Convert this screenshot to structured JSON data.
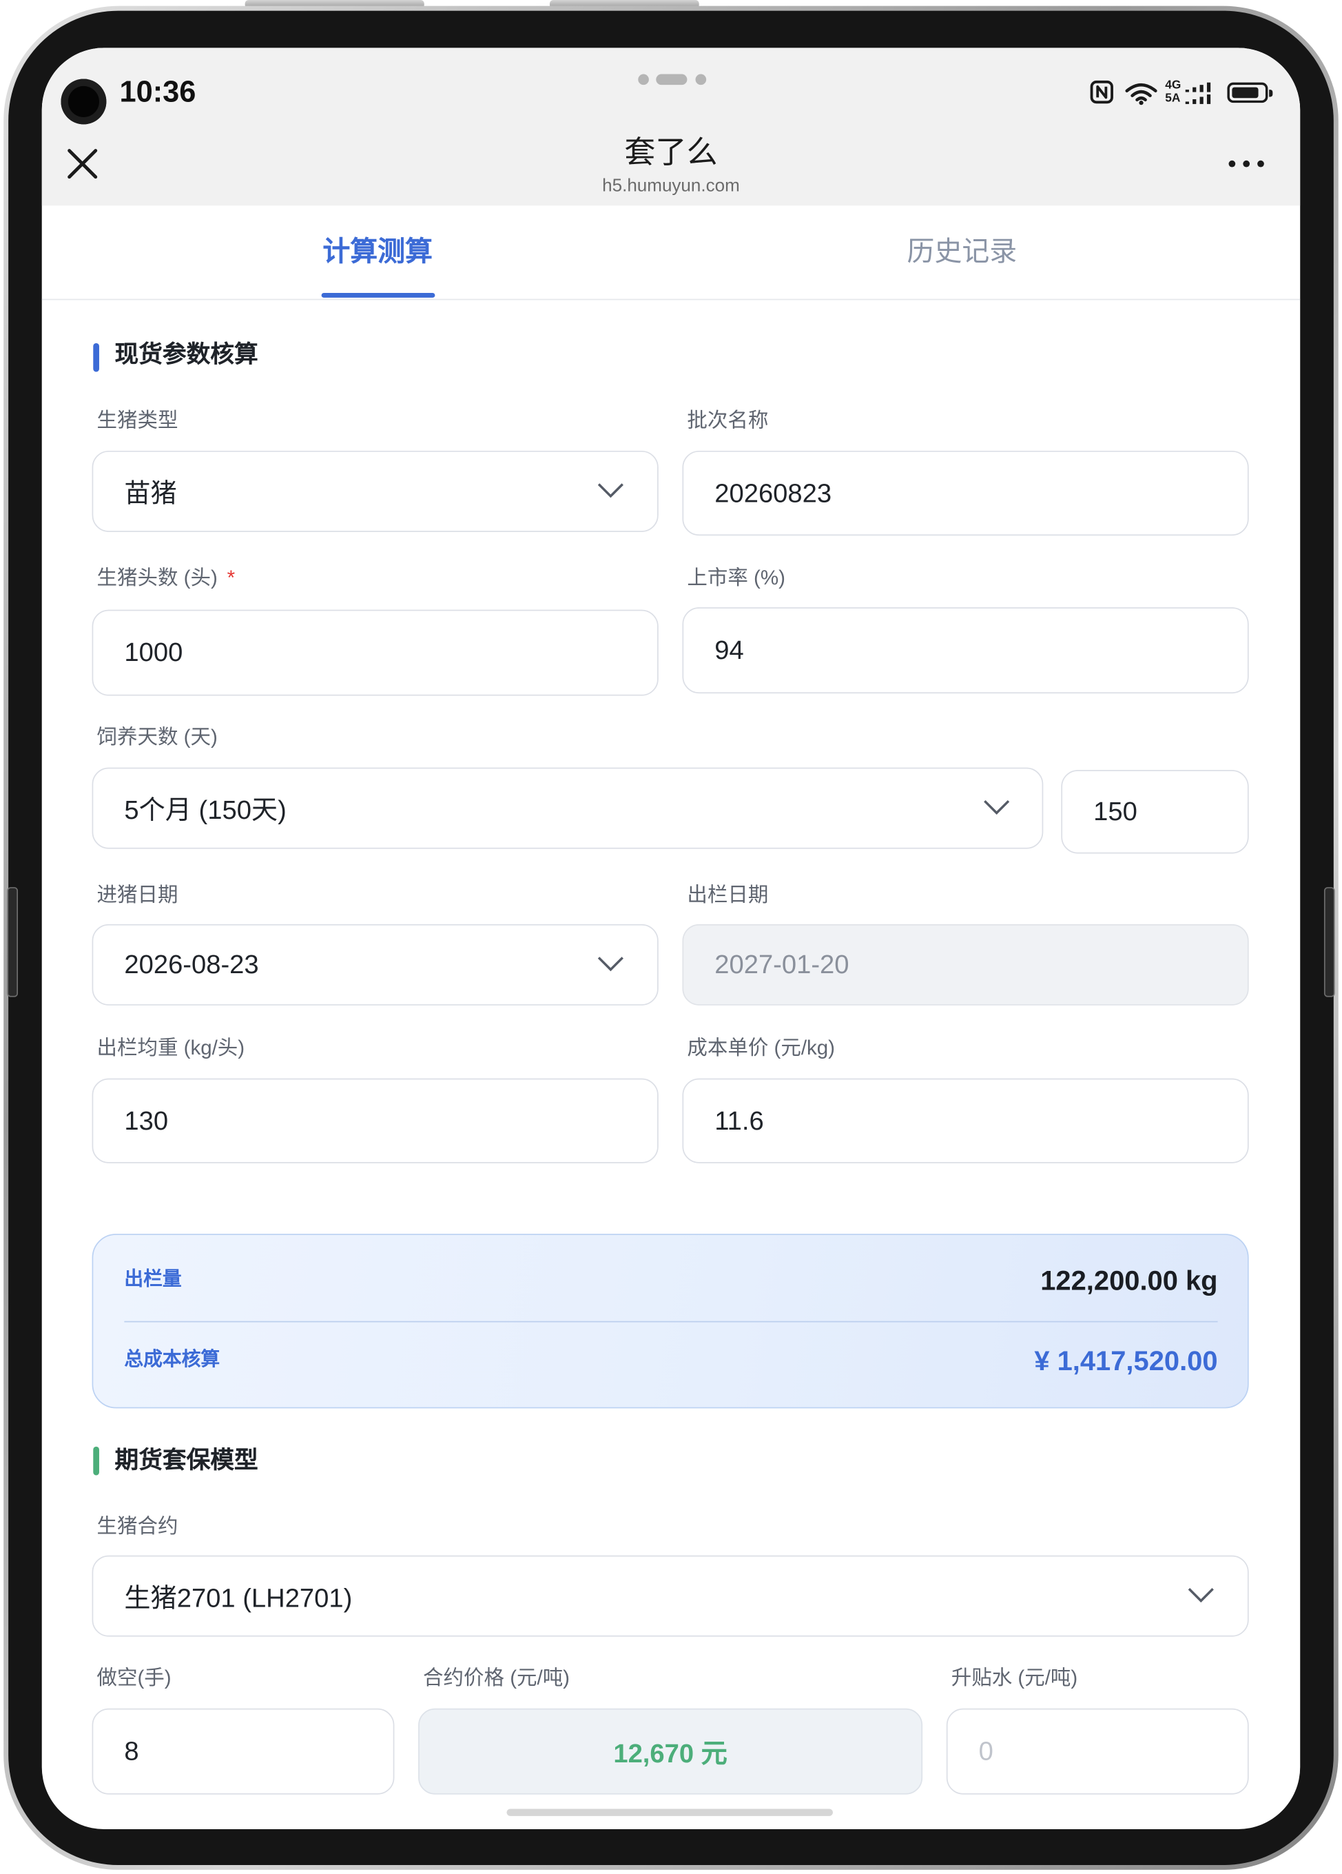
{
  "status_bar": {
    "time": "10:36",
    "network_top": "4G",
    "network_bottom": "5A",
    "battery_level": 0.85
  },
  "header": {
    "title": "套了么",
    "url": "h5.humuyun.com"
  },
  "tabs": [
    {
      "label": "计算测算",
      "active": true
    },
    {
      "label": "历史记录",
      "active": false
    }
  ],
  "spot_section": {
    "title": "现货参数核算",
    "fields": {
      "pig_type": {
        "label": "生猪类型",
        "value": "苗猪"
      },
      "batch_name": {
        "label": "批次名称",
        "value": "20260823"
      },
      "head_count": {
        "label": "生猪头数 (头)",
        "required_mark": "*",
        "value": "1000"
      },
      "market_rate": {
        "label": "上市率 (%)",
        "value": "94"
      },
      "feeding_days": {
        "label": "饲养天数 (天)",
        "selected": "5个月 (150天)",
        "value": "150"
      },
      "entry_date": {
        "label": "进猪日期",
        "value": "2026-08-23"
      },
      "exit_date": {
        "label": "出栏日期",
        "value": "2027-01-20"
      },
      "avg_weight": {
        "label": "出栏均重 (kg/头)",
        "value": "130"
      },
      "unit_cost": {
        "label": "成本单价 (元/kg)",
        "value": "11.6"
      }
    },
    "summary": {
      "output_label": "出栏量",
      "output_value": "122,200.00 kg",
      "total_cost_label": "总成本核算",
      "total_cost_value": "¥ 1,417,520.00"
    }
  },
  "futures_section": {
    "title": "期货套保模型",
    "contract": {
      "label": "生猪合约",
      "selected": "生猪2701 (LH2701)"
    },
    "short_lots": {
      "label": "做空(手)",
      "value": "8"
    },
    "contract_price": {
      "label": "合约价格 (元/吨)",
      "value": "12,670 元"
    },
    "basis": {
      "label": "升贴水 (元/吨)",
      "placeholder": "0"
    }
  },
  "colors": {
    "primary": "#3c6bd6",
    "success": "#4cae7a",
    "required": "#e53935",
    "text_dark": "#1a1d23"
  }
}
